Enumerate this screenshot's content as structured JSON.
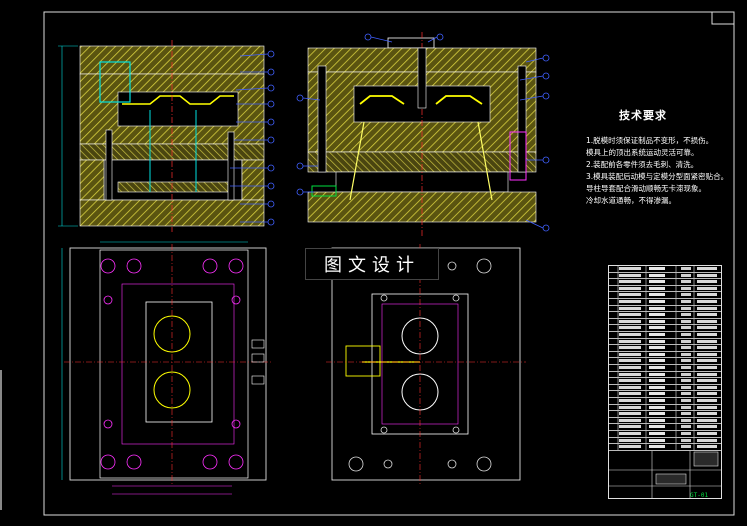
{
  "watermark": {
    "text": "图文设计"
  },
  "tech_requirements": {
    "title": "技术要求",
    "lines": [
      "1.脱模时须保证制品不变形，不损伤。",
      "模具上的顶出系统运动灵活可靠。",
      "2.装配前各零件须去毛刺、清洗。",
      "3.模具装配后动模与定模分型面紧密贴合。",
      "导柱导套配合滑动顺畅无卡滞现象。",
      "冷却水道通畅，不得渗漏。"
    ]
  },
  "title_block": {
    "name_cell": "模具装配图",
    "drawing_code": "GT-01"
  },
  "colors": {
    "background": "#000000",
    "hatch": "#d8d040",
    "outline": "#ffffff",
    "centerline": "#ff3030",
    "dimension": "#00e0e0",
    "balloon": "#4060ff",
    "part": "#ffff00",
    "green": "#00e040",
    "magenta": "#ff30ff"
  }
}
